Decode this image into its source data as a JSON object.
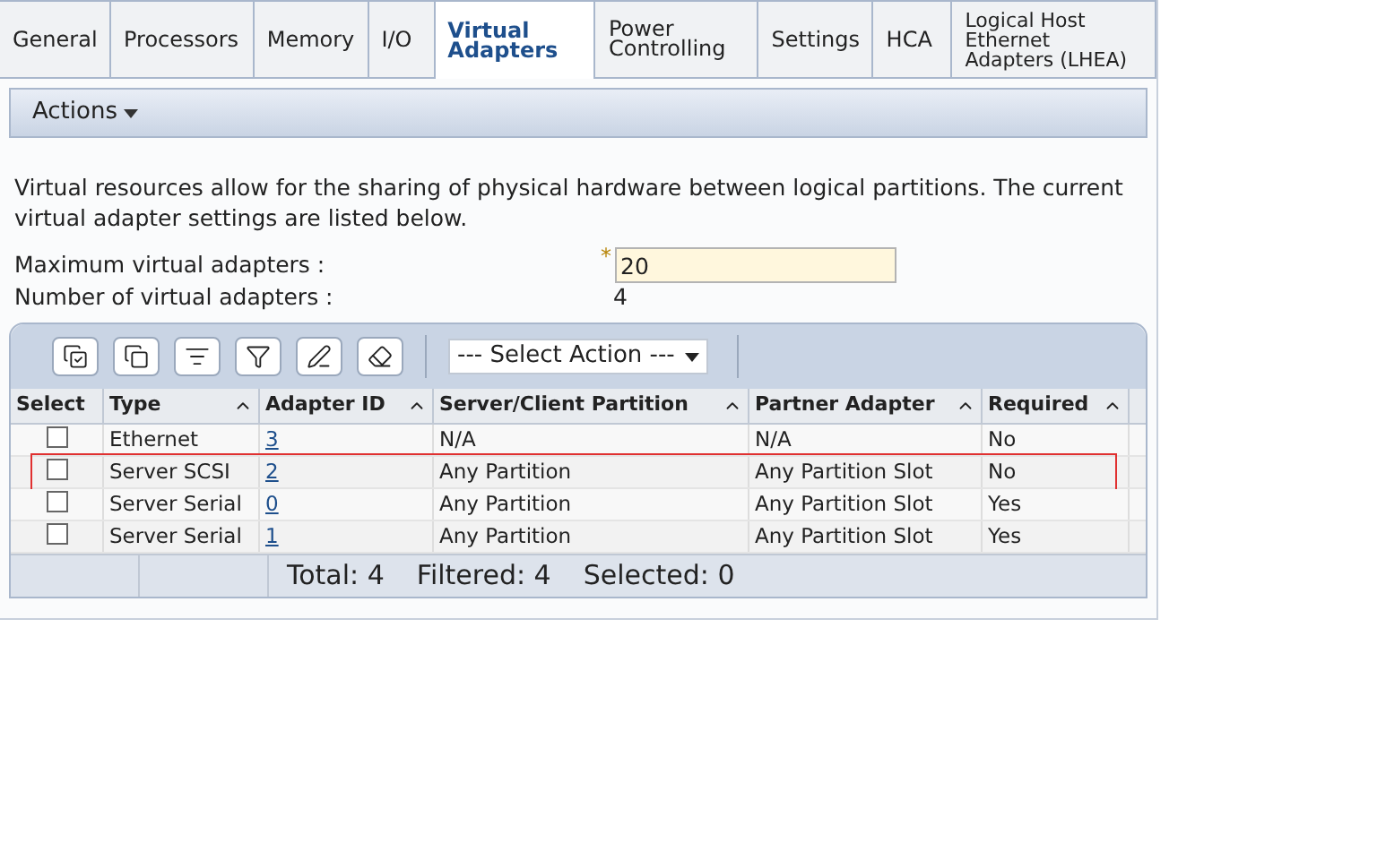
{
  "tabs": [
    {
      "label": "General",
      "selected": false
    },
    {
      "label": "Processors",
      "selected": false
    },
    {
      "label": "Memory",
      "selected": false
    },
    {
      "label": "I/O",
      "selected": false
    },
    {
      "label": "Virtual Adapters",
      "selected": true
    },
    {
      "label": "Power Controlling",
      "selected": false
    },
    {
      "label": "Settings",
      "selected": false
    },
    {
      "label": "HCA",
      "selected": false
    },
    {
      "label": "Logical Host Ethernet Adapters (LHEA)",
      "selected": false
    }
  ],
  "actions_menu": "Actions",
  "description": "Virtual resources allow for the sharing of physical hardware between logical partitions. The current virtual adapter settings are listed below.",
  "fields": [
    {
      "kind": "input",
      "label": "Maximum virtual adapters :",
      "required_mark": "*",
      "value": "20"
    },
    {
      "kind": "text",
      "label": "Number of virtual adapters :",
      "value": "4"
    }
  ],
  "select_action": {
    "placeholder": "--- Select Action ---"
  },
  "table": {
    "columns": [
      "Select",
      "Type",
      "Adapter ID",
      "Server/Client Partition",
      "Partner Adapter",
      "Required"
    ],
    "rows": [
      {
        "checked": false,
        "highlighted": false,
        "type": "Ethernet",
        "adapter_id": "3",
        "partition": "N/A",
        "partner": "N/A",
        "required": "No"
      },
      {
        "checked": false,
        "highlighted": true,
        "type": "Server SCSI",
        "adapter_id": "2",
        "partition": "Any Partition",
        "partner": "Any Partition Slot",
        "required": "No"
      },
      {
        "checked": false,
        "highlighted": false,
        "type": "Server Serial",
        "adapter_id": "0",
        "partition": "Any Partition",
        "partner": "Any Partition Slot",
        "required": "Yes"
      },
      {
        "checked": false,
        "highlighted": false,
        "type": "Server Serial",
        "adapter_id": "1",
        "partition": "Any Partition",
        "partner": "Any Partition Slot",
        "required": "Yes"
      }
    ],
    "footer": {
      "total": "Total: 4",
      "filtered": "Filtered: 4",
      "selected": "Selected: 0"
    }
  }
}
